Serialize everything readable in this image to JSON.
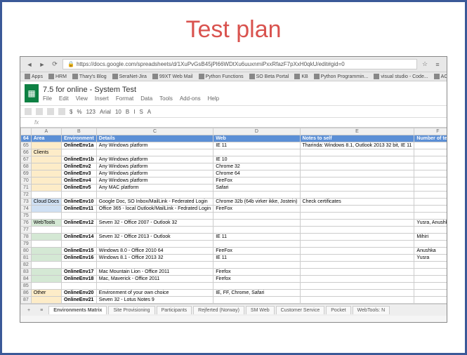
{
  "slide": {
    "title": "Test plan"
  },
  "browser": {
    "url": "https://docs.google.com/spreadsheets/d/1XuPvGsB45jPl66WDtXu6uuxnmiPxxRfazF7pXxH0qkU/edit#gid=0",
    "bookmarks": [
      "Apps",
      "HRM",
      "Thary's Blog",
      "SeraNet-Jira",
      "99XT Web Mail",
      "Python Functions",
      "SO Beta Portal",
      "KB",
      "Python Programmin...",
      "visual studio - Code...",
      "ACTIVAT"
    ]
  },
  "doc": {
    "title": "7.5 for online - System Test",
    "menus": [
      "File",
      "Edit",
      "View",
      "Insert",
      "Format",
      "Data",
      "Tools",
      "Add-ons",
      "Help"
    ],
    "toolbar": [
      "",
      "",
      "",
      "",
      "$",
      "%",
      "123",
      "Arial",
      "10",
      "B",
      "I",
      "S",
      "A"
    ]
  },
  "formula": "fx",
  "columns": [
    "",
    "A",
    "B",
    "C",
    "D",
    "E",
    "F"
  ],
  "headers": {
    "area": "Area",
    "env": "Environment",
    "details": "Details",
    "web": "Web",
    "notes": "Notes to self",
    "testers": "Number of testers"
  },
  "rows": [
    {
      "n": "65",
      "cat": "",
      "env": "OnlineEnv1a",
      "details": "Any Windows platform",
      "web": "IE 11",
      "notes": "Tharinda: Windows 8.1, Outlook 2013 32 bit, IE 11",
      "t": "",
      "cls": "cat-cell"
    },
    {
      "n": "66",
      "cat": "Clients",
      "env": "",
      "details": "",
      "web": "",
      "notes": "",
      "t": "",
      "cls": "cat-cell"
    },
    {
      "n": "67",
      "cat": "",
      "env": "OnlineEnv1b",
      "details": "Any Windows platform",
      "web": "IE 10",
      "notes": "",
      "t": "",
      "cls": "cat-cell"
    },
    {
      "n": "68",
      "cat": "",
      "env": "OnlineEnv2",
      "details": "Any Windows platform",
      "web": "Chrome 32",
      "notes": "",
      "t": "",
      "cls": "cat-cell"
    },
    {
      "n": "69",
      "cat": "",
      "env": "OnlineEnv3",
      "details": "Any Windows platform",
      "web": "Chrome 64",
      "notes": "",
      "t": "",
      "cls": "cat-cell"
    },
    {
      "n": "70",
      "cat": "",
      "env": "OnlineEnv4",
      "details": "Any Windows platform",
      "web": "FireFox",
      "notes": "",
      "t": "",
      "cls": "cat-cell"
    },
    {
      "n": "71",
      "cat": "",
      "env": "OnlineEnv5",
      "details": "Any MAC platform",
      "web": "Safari",
      "notes": "",
      "t": "",
      "cls": "cat-cell"
    },
    {
      "n": "72",
      "cat": "",
      "env": "",
      "details": "",
      "web": "",
      "notes": "",
      "t": "",
      "cls": ""
    },
    {
      "n": "73",
      "cat": "Cloud Docs",
      "env": "OnlineEnv10",
      "details": "Google Doc, SO Inbox/MailLink - Federated Login",
      "web": "Chrome 32b (64b virker ikke, Jostein)",
      "notes": "Check certificates",
      "t": "",
      "cls": "cat-cell-blue"
    },
    {
      "n": "74",
      "cat": "",
      "env": "OnlineEnv11",
      "details": "Office 365 - local Outlook/MailLink - Fedrated Login",
      "web": "FireFox",
      "notes": "",
      "t": "",
      "cls": "cat-cell-blue"
    },
    {
      "n": "75",
      "cat": "",
      "env": "",
      "details": "",
      "web": "",
      "notes": "",
      "t": "",
      "cls": ""
    },
    {
      "n": "76",
      "cat": "WebTools",
      "env": "OnlineEnv12",
      "details": "Seven 32 - Office 2007 - Outlook 32",
      "web": "",
      "notes": "",
      "t": "Yusra, Anushka",
      "cls": "cat-cell-green"
    },
    {
      "n": "77",
      "cat": "",
      "env": "",
      "details": "",
      "web": "",
      "notes": "",
      "t": "",
      "cls": ""
    },
    {
      "n": "78",
      "cat": "",
      "env": "OnlineEnv14",
      "details": "Seven 32 - Office 2013 - Outlook",
      "web": "IE 11",
      "notes": "",
      "t": "Mihiri",
      "cls": "cat-cell-green"
    },
    {
      "n": "79",
      "cat": "",
      "env": "",
      "details": "",
      "web": "",
      "notes": "",
      "t": "",
      "cls": ""
    },
    {
      "n": "80",
      "cat": "",
      "env": "OnlineEnv15",
      "details": "Windows 8.0 - Office 2010 64",
      "web": "FireFox",
      "notes": "",
      "t": "Anushka",
      "cls": "cat-cell-green"
    },
    {
      "n": "81",
      "cat": "",
      "env": "OnlineEnv16",
      "details": "Windows 8.1 - Office 2013 32",
      "web": "IE 11",
      "notes": "",
      "t": "Yusra",
      "cls": "cat-cell-green"
    },
    {
      "n": "82",
      "cat": "",
      "env": "",
      "details": "",
      "web": "",
      "notes": "",
      "t": "",
      "cls": ""
    },
    {
      "n": "83",
      "cat": "",
      "env": "OnlineEnv17",
      "details": "Mac Mountain Lion - Office 2011",
      "web": "Firefox",
      "notes": "",
      "t": "",
      "cls": "cat-cell-green"
    },
    {
      "n": "84",
      "cat": "",
      "env": "OnlineEnv18",
      "details": "Mac, Maverick - Office 2011",
      "web": "Firefox",
      "notes": "",
      "t": "",
      "cls": "cat-cell-green"
    },
    {
      "n": "85",
      "cat": "",
      "env": "",
      "details": "",
      "web": "",
      "notes": "",
      "t": "",
      "cls": ""
    },
    {
      "n": "86",
      "cat": "Other",
      "env": "OnlineEnv20",
      "details": "Environment of your own choice",
      "web": "IE, FF, Chrome, Safari",
      "notes": "",
      "t": "",
      "cls": "cat-cell"
    },
    {
      "n": "87",
      "cat": "",
      "env": "OnlineEnv21",
      "details": "Seven 32 - Lotus Notes 9",
      "web": "",
      "notes": "",
      "t": "",
      "cls": "cat-cell"
    }
  ],
  "tabs": [
    "Environments Matrix",
    "Site Provisioning",
    "Participants",
    "Rejferted (Norway)",
    "SM Web",
    "Customer Service",
    "Pocket",
    "WebTools: N"
  ]
}
